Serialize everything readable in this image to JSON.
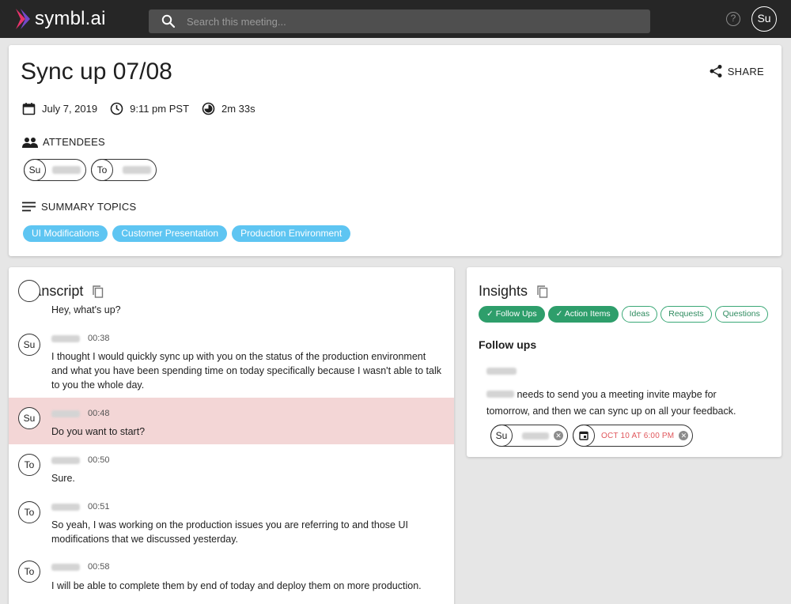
{
  "brand": {
    "name": "symbl.ai"
  },
  "search": {
    "placeholder": "Search this meeting..."
  },
  "header": {
    "help_glyph": "?",
    "user_initials": "Su"
  },
  "meeting": {
    "title": "Sync up 07/08",
    "share_label": "SHARE",
    "date": "July 7, 2019",
    "time": "9:11 pm PST",
    "duration": "2m 33s",
    "attendees_label": "ATTENDEES",
    "attendees": [
      {
        "initials": "Su"
      },
      {
        "initials": "To"
      }
    ],
    "summary_label": "SUMMARY TOPICS",
    "topics": [
      "UI Modifications",
      "Customer Presentation",
      "Production Environment"
    ]
  },
  "transcript": {
    "title": "Transcript",
    "entries": [
      {
        "initials": "",
        "time": "",
        "text": "Hey, what's up?"
      },
      {
        "initials": "Su",
        "time": "00:38",
        "text": "I thought I would quickly sync up with you on the status of the production environment and what you have been spending time on today specifically because I wasn't able to talk to you the whole day."
      },
      {
        "initials": "Su",
        "time": "00:48",
        "text": "Do you want to start?"
      },
      {
        "initials": "To",
        "time": "00:50",
        "text": "Sure."
      },
      {
        "initials": "To",
        "time": "00:51",
        "text": "So yeah, I was working on the production issues you are referring to and those UI modifications that we discussed yesterday."
      },
      {
        "initials": "To",
        "time": "00:58",
        "text": "I will be able to complete them by end of today and deploy them on more production."
      }
    ]
  },
  "insights": {
    "title": "Insights",
    "filters": [
      {
        "label": "Follow Ups",
        "active": true
      },
      {
        "label": "Action Items",
        "active": true
      },
      {
        "label": "Ideas",
        "active": false
      },
      {
        "label": "Requests",
        "active": false
      },
      {
        "label": "Questions",
        "active": false
      }
    ],
    "followups_title": "Follow ups",
    "followup_text": "needs to send you a meeting invite maybe for tomorrow, and then we can sync up on all your feedback.",
    "assignee_initials": "Su",
    "due_date": "OCT 10 AT 6:00 PM"
  },
  "colors": {
    "topbar": "#262626",
    "topic_chip": "#5ec5f2",
    "insight_green": "#2e9e6b",
    "highlight_row": "#f3d6d6",
    "due_date_red": "#e0565b"
  }
}
